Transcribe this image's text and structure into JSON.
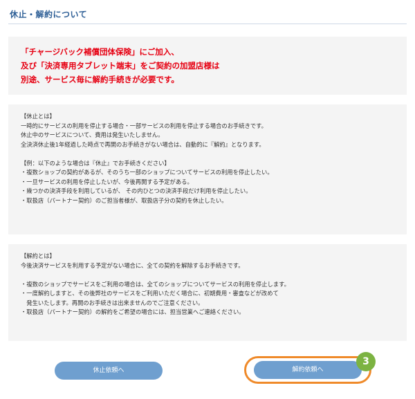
{
  "page": {
    "title": "休止・解約について"
  },
  "notice": {
    "lines": [
      "「チャージバック補償団体保険」にご加入、",
      "及び「決済専用タブレット端末」をご契約の加盟店様は",
      "別途、サービス毎に解約手続きが必要です。"
    ]
  },
  "kyushi_section": {
    "lines": [
      "【休止とは】",
      "一時的にサービスの利用を停止する場合・一部サービスの利用を停止する場合のお手続きです。",
      "休止中のサービスについて、費用は発生いたしません。",
      "全決済休止後1年経過した時点で再開のお手続きがない場合は、自動的に『解約』となります。",
      "",
      "【例：以下のような場合は『休止』でお手続きください】",
      "・複数ショップの契約があるが、そのうち一部のショップについてサービスの利用を停止したい。",
      "・一旦サービスの利用を停止したいが、今後再開する予定がある。",
      "・幾つかの決済手段を利用しているが、 その内ひとつの決済手段だけ利用を停止したい。",
      "・取扱店（パートナー契約）のご担当者様が、取扱店子分の契約を休止したい。"
    ]
  },
  "kaiyaku_section": {
    "lines": [
      "【解約とは】",
      "今後決済サービスを利用する予定がない場合に、全ての契約を解除するお手続きです。",
      "",
      "・複数のショップでサービスをご利用の場合は、全てのショップについてサービスの利用を停止します。",
      "・一度解約しますと、その後弊社のサービスをご利用いただく場合に、初期費用・審査などが改めて",
      "　発生いたします。再開のお手続きは出来ませんのでご注意ください。",
      "・取扱店（パートナー契約）の解約をご希望の場合には、担当営業へご連絡ください。"
    ]
  },
  "buttons": {
    "kyushi_label": "休止依頼へ",
    "kaiyaku_label": "解約依頼へ"
  },
  "annotation": {
    "step_number": "3",
    "ring_color": "#ef8a2a",
    "badge_color": "#7cb342"
  },
  "colors": {
    "title": "#2e5f96",
    "notice_text": "#e60012",
    "button": "#6f9fcf",
    "box_background": "#f4f4f4"
  }
}
